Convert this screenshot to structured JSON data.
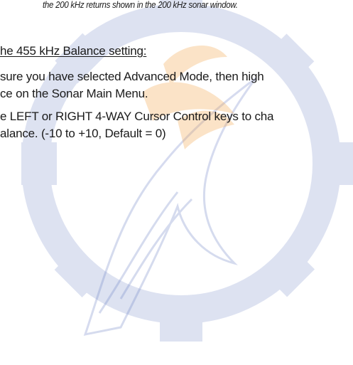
{
  "document": {
    "note_text": "the 200 kHz returns shown in the 200 kHz sonar window.",
    "section_heading": "he 455 kHz Balance setting:",
    "steps": [
      {
        "lines": [
          "sure you have selected Advanced Mode, then high",
          "ce on the Sonar Main Menu."
        ]
      },
      {
        "lines": [
          "e LEFT or RIGHT 4-WAY Cursor Control keys to cha",
          "alance. (-10 to +10, Default = 0)"
        ]
      }
    ]
  },
  "watermark": {
    "colors": {
      "primary": "#6a7fc4",
      "accent": "#f3a64a"
    }
  }
}
